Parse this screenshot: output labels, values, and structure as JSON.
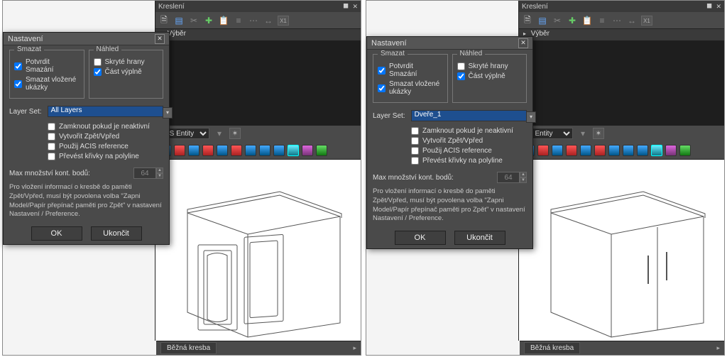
{
  "left": {
    "kresleni": {
      "title": "Kreslení"
    },
    "toolbar_badge": "X1",
    "vyber": "Výběr",
    "entity_label": "SS Entity",
    "status": "Běžná kresba",
    "dialog": {
      "title": "Nastavení",
      "grp_smazat": "Smazat",
      "grp_nahled": "Náhled",
      "chk_potvrdit": "Potvrdit Smazání",
      "chk_vlozene": "Smazat vložené ukázky",
      "chk_skryte": "Skryté hrany",
      "chk_vyplne": "Část výplně",
      "layer_label": "Layer Set:",
      "layer_value": "All Layers",
      "opt_zamknout": "Zamknout pokud je neaktivní",
      "opt_zpet": "Vytvořit Zpět/Vpřed",
      "opt_acis": "Použij ACIS reference",
      "opt_poly": "Převést křivky na polyline",
      "max_label": "Max množství kont. bodů:",
      "max_value": "64",
      "info": "Pro vložení informací o kresbě do paměti Zpět/Vpřed, musí být povolena volba \"Zapni Model/Papír přepínač paměti pro Zpět\" v nastavení Nastavení / Preference.",
      "btn_ok": "OK",
      "btn_cancel": "Ukončit"
    }
  },
  "right": {
    "kresleni": {
      "title": "Kreslení"
    },
    "toolbar_badge": "X1",
    "vyber": "Výběr",
    "entity_label": "S Entity",
    "status": "Běžná kresba",
    "dialog": {
      "title": "Nastavení",
      "grp_smazat": "Smazat",
      "grp_nahled": "Náhled",
      "chk_potvrdit": "Potvrdit Smazání",
      "chk_vlozene": "Smazat vložené ukázky",
      "chk_skryte": "Skryté hrany",
      "chk_vyplne": "Část výplně",
      "layer_label": "Layer Set:",
      "layer_value": "Dveře_1",
      "opt_zamknout": "Zamknout pokud je neaktivní",
      "opt_zpet": "Vytvořit Zpět/Vpřed",
      "opt_acis": "Použij ACIS reference",
      "opt_poly": "Převést křivky na polyline",
      "max_label": "Max množství kont. bodů:",
      "max_value": "64",
      "info": "Pro vložení informací o kresbě do paměti Zpět/Vpřed, musí být povolena volba \"Zapni Model/Papír přepínač paměti pro Zpět\" v nastavení Nastavení / Preference.",
      "btn_ok": "OK",
      "btn_cancel": "Ukončit"
    }
  }
}
